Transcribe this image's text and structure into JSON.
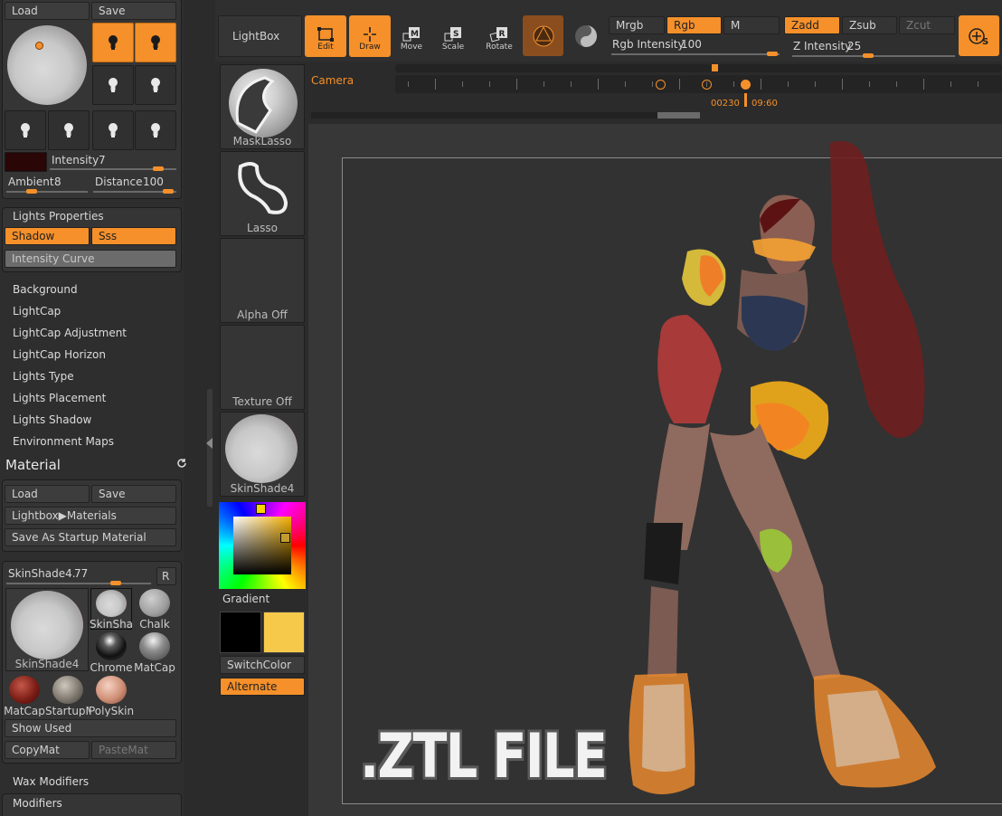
{
  "light": {
    "load": "Load",
    "save": "Save",
    "intensity_label": "Intensity",
    "intensity_value": "7",
    "ambient_label": "Ambient",
    "ambient_value": "8",
    "distance_label": "Distance",
    "distance_value": "100"
  },
  "lights_properties": {
    "title": "Lights Properties",
    "shadow": "Shadow",
    "sss": "Sss",
    "intensity_curve": "Intensity Curve"
  },
  "light_menu": [
    "Background",
    "LightCap",
    "LightCap Adjustment",
    "LightCap Horizon",
    "Lights Type",
    "Lights Placement",
    "Lights Shadow",
    "Environment Maps"
  ],
  "material": {
    "title": "Material",
    "load": "Load",
    "save": "Save",
    "lightbox_materials": "Lightbox▶Materials",
    "save_startup": "Save As Startup Material",
    "current_name": "SkinShade4.",
    "current_value": "77",
    "r_button": "R",
    "big_label": "SkinShade4",
    "swatches": [
      "SkinSha",
      "Chalk",
      "Chrome",
      "MatCap",
      "MatCap",
      "StartupM",
      "PolySkin"
    ],
    "show_used": "Show Used",
    "copy": "CopyMat",
    "paste": "PasteMat"
  },
  "bottom_menu": [
    "Wax Modifiers",
    "Modifiers"
  ],
  "toolbar": {
    "lightbox": "LightBox",
    "edit": "Edit",
    "draw": "Draw",
    "move": "Move",
    "scale": "Scale",
    "rotate": "Rotate",
    "mrgb": "Mrgb",
    "rgb": "Rgb",
    "m": "M",
    "rgb_intensity_label": "Rgb Intensity",
    "rgb_intensity_value": "100",
    "zadd": "Zadd",
    "zsub": "Zsub",
    "zcut": "Zcut",
    "z_intensity_label": "Z Intensity",
    "z_intensity_value": "25"
  },
  "timeline": {
    "camera": "Camera",
    "time_left": "00230",
    "time_right": "09:60"
  },
  "shelf": {
    "masklasso": "MaskLasso",
    "lasso": "Lasso",
    "alpha": "Alpha Off",
    "texture": "Texture Off",
    "material": "SkinShade4",
    "gradient": "Gradient",
    "switch_color": "SwitchColor",
    "alternate": "Alternate"
  },
  "canvas": {
    "watermark": ".ZTL FILE"
  },
  "colors": {
    "accent": "#f5902a",
    "secondary_color": "#f7c94a",
    "main_color": "#000000"
  }
}
